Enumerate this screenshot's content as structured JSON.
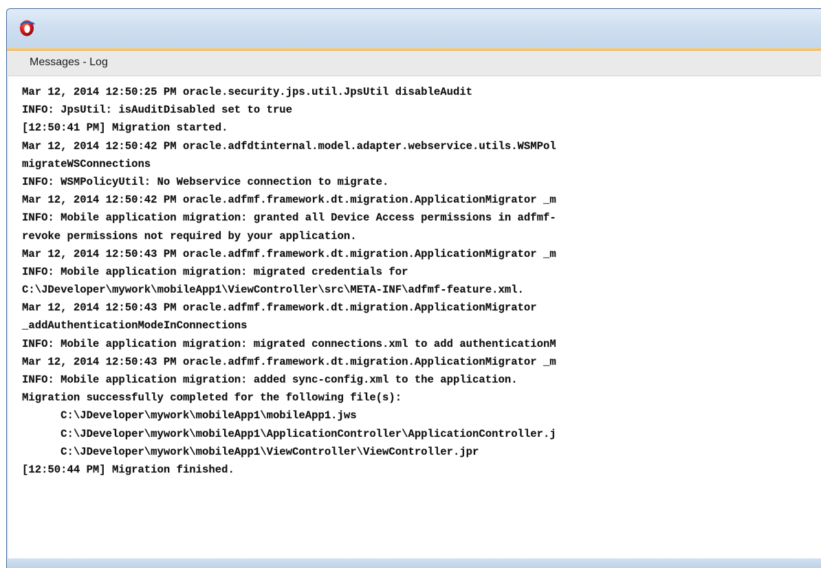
{
  "window": {
    "icon": "oracle-jdeveloper-logo-icon",
    "accent_color": "#f1b65c",
    "titlebar_color": "#cfdff0"
  },
  "panel": {
    "tab_label": "Messages - Log"
  },
  "log": {
    "lines": [
      "Mar 12, 2014 12:50:25 PM oracle.security.jps.util.JpsUtil disableAudit",
      "INFO: JpsUtil: isAuditDisabled set to true",
      "[12:50:41 PM] Migration started.",
      "Mar 12, 2014 12:50:42 PM oracle.adfdtinternal.model.adapter.webservice.utils.WSMPol",
      "migrateWSConnections",
      "INFO: WSMPolicyUtil: No Webservice connection to migrate.",
      "Mar 12, 2014 12:50:42 PM oracle.adfmf.framework.dt.migration.ApplicationMigrator _m",
      "INFO: Mobile application migration: granted all Device Access permissions in adfmf-",
      "revoke permissions not required by your application.",
      "Mar 12, 2014 12:50:43 PM oracle.adfmf.framework.dt.migration.ApplicationMigrator _m",
      "INFO: Mobile application migration: migrated credentials for",
      "C:\\JDeveloper\\mywork\\mobileApp1\\ViewController\\src\\META-INF\\adfmf-feature.xml.",
      "Mar 12, 2014 12:50:43 PM oracle.adfmf.framework.dt.migration.ApplicationMigrator",
      "_addAuthenticationModeInConnections",
      "INFO: Mobile application migration: migrated connections.xml to add authenticationM",
      "Mar 12, 2014 12:50:43 PM oracle.adfmf.framework.dt.migration.ApplicationMigrator _m",
      "INFO: Mobile application migration: added sync-config.xml to the application.",
      "Migration successfully completed for the following file(s):",
      "      C:\\JDeveloper\\mywork\\mobileApp1\\mobileApp1.jws",
      "      C:\\JDeveloper\\mywork\\mobileApp1\\ApplicationController\\ApplicationController.j",
      "      C:\\JDeveloper\\mywork\\mobileApp1\\ViewController\\ViewController.jpr",
      "[12:50:44 PM] Migration finished."
    ]
  }
}
